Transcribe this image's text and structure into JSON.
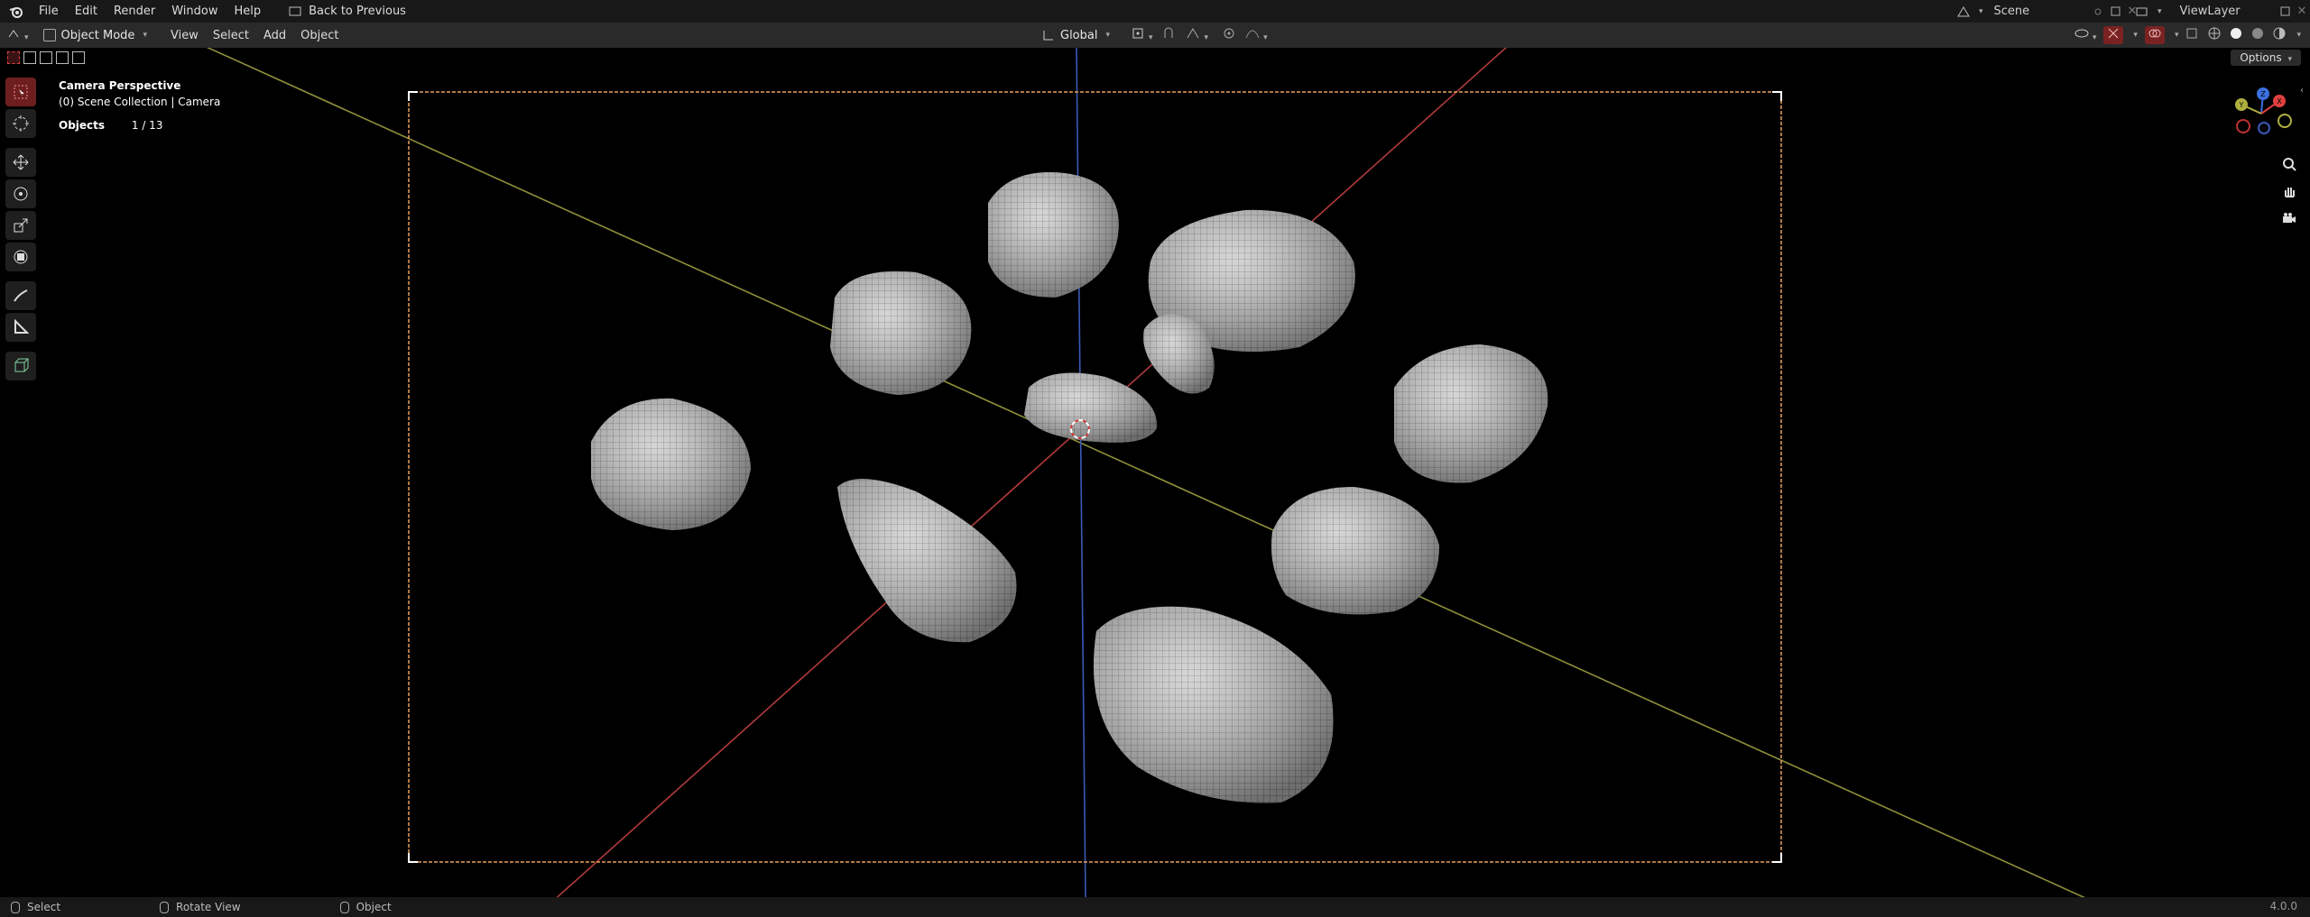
{
  "topbar": {
    "menus": [
      "File",
      "Edit",
      "Render",
      "Window",
      "Help"
    ],
    "back_label": "Back to Previous",
    "scene": "Scene",
    "view_layer": "ViewLayer"
  },
  "header": {
    "mode": "Object Mode",
    "menus": [
      "View",
      "Select",
      "Add",
      "Object"
    ],
    "orientation": "Global"
  },
  "toolsettings": {
    "options_label": "Options"
  },
  "viewport": {
    "view_name": "Camera Perspective",
    "collection_path": "(0) Scene Collection | Camera",
    "objects_label": "Objects",
    "objects_count": "1 / 13"
  },
  "statusbar": {
    "items": [
      "Select",
      "Rotate View",
      "Object"
    ],
    "version": "4.0.0"
  },
  "colors": {
    "x_axis": "#b23a3a",
    "y_axis": "#9a9a3a",
    "z_axis": "#3a5ab8",
    "camera_frame": "#e8a060",
    "active_tool": "#6d1f1f"
  },
  "icons": [
    "blender-logo-icon",
    "select-box-icon",
    "cursor-icon",
    "move-icon",
    "rotate-icon",
    "scale-icon",
    "transform-icon",
    "annotate-icon",
    "measure-icon",
    "add-cube-icon",
    "zoom-icon",
    "hand-pan-icon",
    "camera-view-icon"
  ]
}
